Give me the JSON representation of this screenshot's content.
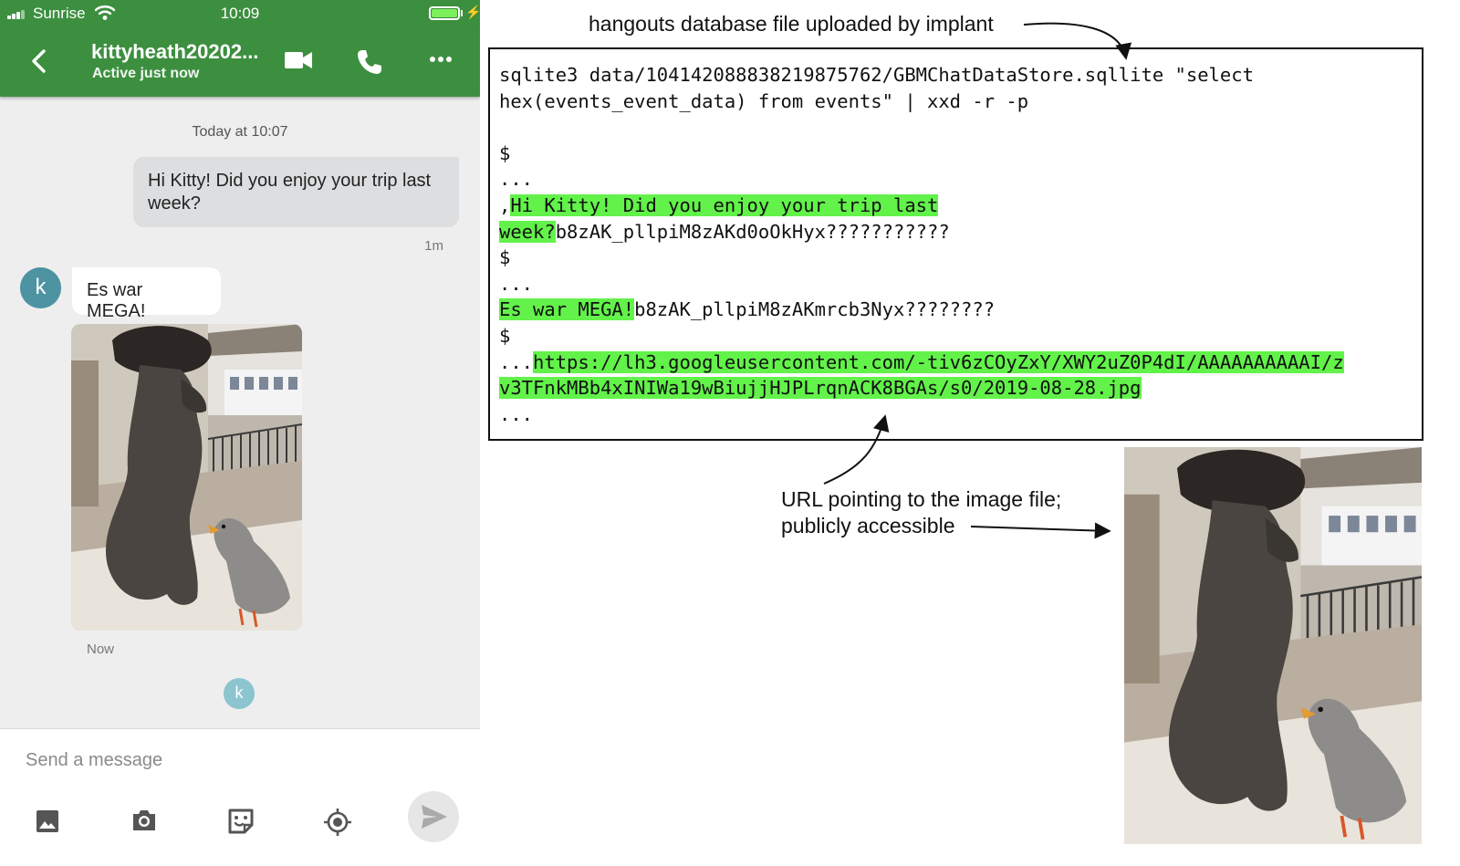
{
  "status_bar": {
    "carrier": "Sunrise",
    "time": "10:09"
  },
  "app_bar": {
    "contact_name": "kittyheath20202...",
    "presence": "Active just now",
    "color": "#3d8f40"
  },
  "chat": {
    "day_label": "Today at 10:07",
    "outgoing_message": {
      "text": "Hi Kitty! Did you enjoy your trip last week?",
      "time": "1m"
    },
    "incoming_message": {
      "avatar_letter": "k",
      "text": "Es war MEGA!",
      "image_time": "Now"
    },
    "read_receipt_letter": "k"
  },
  "composer": {
    "placeholder": "Send a message",
    "tools": [
      "gallery-icon",
      "camera-icon",
      "sticker-icon",
      "location-icon"
    ]
  },
  "annotations": {
    "top_label": "hangouts database file uploaded by implant",
    "url_label_line1": "URL pointing to the image file;",
    "url_label_line2": "publicly accessible"
  },
  "terminal": {
    "cmd1": "sqlite3 data/104142088838219875762/GBMChatDataStore.sqllite \"select",
    "cmd2": "hex(events_event_data) from events\" | xxd -r -p",
    "prompt": "$",
    "ellipsis": "...",
    "comma": ",",
    "msg1_a": "Hi Kitty! Did you enjoy your trip last",
    "msg1_b": "week?",
    "msg1_tail": "b8zAK_pllpiM8zAKd0oOkHyx???????????",
    "msg2": "Es war MEGA!",
    "msg2_tail": "b8zAK_pllpiM8zAKmrcb3Nyx????????",
    "url_a": "https://lh3.googleusercontent.com/-tiv6zCOyZxY/XWY2uZ0P4dI/AAAAAAAAAAI/z",
    "url_b": "v3TFnkMBb4xINIWa19wBiujjHJPLrqnACK8BGAs/s0/2019-08-28.jpg",
    "highlight_color": "#62f24a"
  }
}
